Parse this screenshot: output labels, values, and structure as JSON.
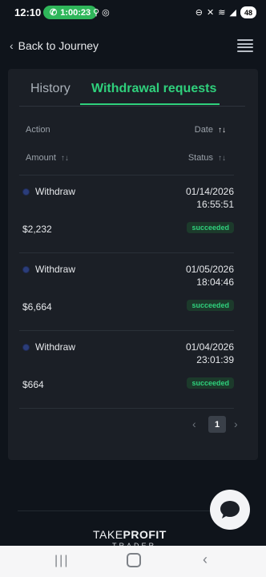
{
  "status_bar": {
    "time": "12:10",
    "call_timer": "1:00:23",
    "battery": "48",
    "icons_left": [
      "antenna-icon",
      "instagram-icon"
    ],
    "icons_right": [
      "dnd-icon",
      "mute-icon",
      "wifi-icon",
      "signal-icon"
    ]
  },
  "header": {
    "back_label": "Back to Journey"
  },
  "tabs": [
    {
      "label": "History",
      "active": false
    },
    {
      "label": "Withdrawal requests",
      "active": true
    }
  ],
  "table": {
    "headers": {
      "action": "Action",
      "date": "Date",
      "amount": "Amount",
      "status": "Status"
    },
    "rows": [
      {
        "action": "Withdraw",
        "date": "01/14/2026",
        "time": "16:55:51",
        "amount": "$2,232",
        "status": "succeeded"
      },
      {
        "action": "Withdraw",
        "date": "01/05/2026",
        "time": "18:04:46",
        "amount": "$6,664",
        "status": "succeeded"
      },
      {
        "action": "Withdraw",
        "date": "01/04/2026",
        "time": "23:01:39",
        "amount": "$664",
        "status": "succeeded"
      }
    ]
  },
  "pagination": {
    "current_page": "1"
  },
  "footer": {
    "logo_regular": "TAKE",
    "logo_bold": "PROFIT",
    "logo_sub": "TRADER"
  },
  "colors": {
    "accent": "#2fd07c",
    "background": "#0f141b",
    "card": "#1b1f26"
  }
}
